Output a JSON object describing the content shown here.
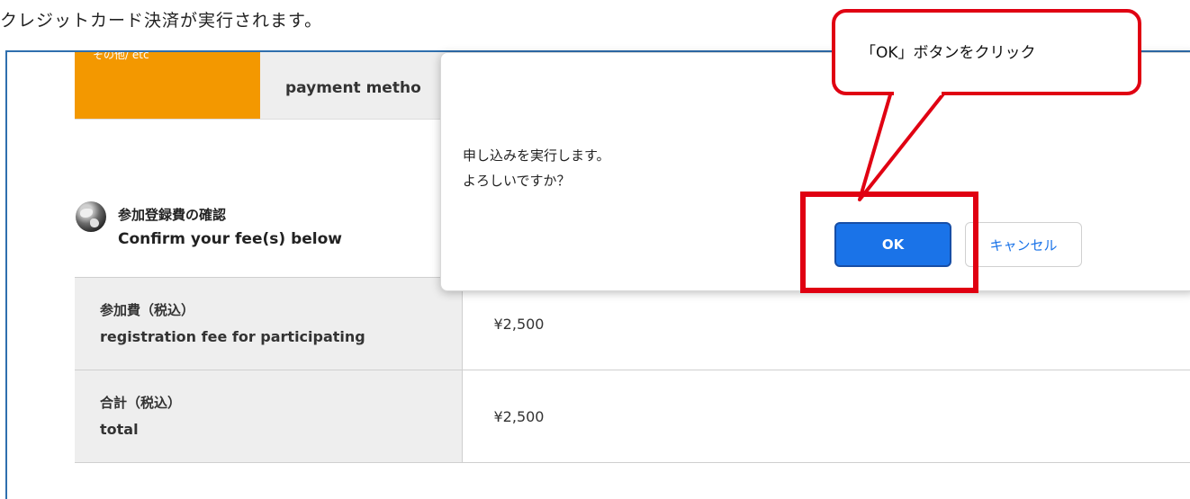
{
  "caption": "クレジットカード決済が実行されます。",
  "browser": {
    "address_fragment": "",
    "payment_method_row": {
      "left_label": "その他/ etc",
      "label": "payment metho"
    }
  },
  "section": {
    "icon": "globe-icon",
    "title_ja": "参加登録費の確認",
    "title_en": "Confirm your fee(s) below"
  },
  "fee_table": {
    "rows": [
      {
        "label_ja": "参加費（税込）",
        "label_en": "registration fee for participating",
        "value": "¥2,500"
      },
      {
        "label_ja": "合計（税込）",
        "label_en": "total",
        "value": "¥2,500"
      }
    ]
  },
  "dialog": {
    "message_line1": "申し込みを実行します。",
    "message_line2": "よろしいですか？",
    "ok_label": "OK",
    "cancel_label": "キャンセル"
  },
  "annotation": {
    "callout_text": "「OK」ボタンをクリック",
    "color": "#e00012"
  }
}
